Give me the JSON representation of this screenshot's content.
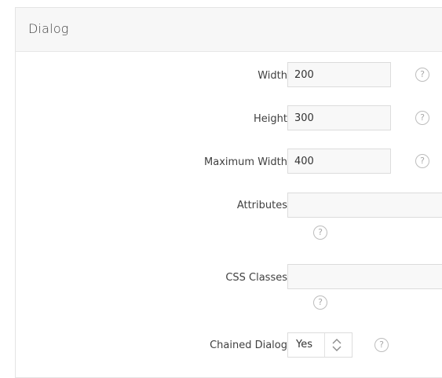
{
  "panel": {
    "title": "Dialog"
  },
  "fields": {
    "width": {
      "label": "Width",
      "value": "200"
    },
    "height": {
      "label": "Height",
      "value": "300"
    },
    "max_width": {
      "label": "Maximum Width",
      "value": "400"
    },
    "attributes": {
      "label": "Attributes",
      "value": ""
    },
    "css_classes": {
      "label": "CSS Classes",
      "value": ""
    },
    "chained_dialog": {
      "label": "Chained Dialog",
      "value": "Yes",
      "options": [
        "Yes"
      ]
    }
  },
  "help": {
    "glyph": "?"
  },
  "icons": {
    "help": "help-icon",
    "select_arrows": "chevron-up-down-icon"
  },
  "colors": {
    "header_bg": "#f7f7f7",
    "field_bg": "#f8f8f8",
    "border": "#dcdcdc",
    "text": "#404040",
    "help_icon": "#a8a8a8"
  }
}
